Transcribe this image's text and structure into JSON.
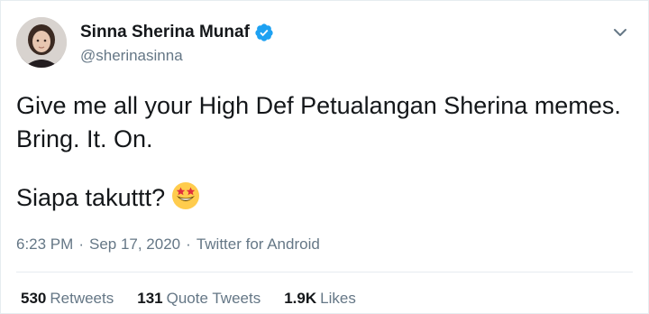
{
  "author": {
    "display_name": "Sinna Sherina Munaf",
    "handle": "@sherinasinna"
  },
  "tweet": {
    "line1": "Give me all your High Def Petualangan Sherina memes.",
    "line2": "Bring. It. On.",
    "line3": "Siapa takuttt?",
    "emoji": "star-struck-emoji"
  },
  "meta": {
    "time": "6:23 PM",
    "date": "Sep 17, 2020",
    "source": "Twitter for Android",
    "separator": "·"
  },
  "stats": {
    "retweets_count": "530",
    "retweets_label": "Retweets",
    "quotes_count": "131",
    "quotes_label": "Quote Tweets",
    "likes_count": "1.9K",
    "likes_label": "Likes"
  },
  "colors": {
    "verified_blue": "#1da1f2",
    "secondary_text": "#657786",
    "primary_text": "#14171a"
  }
}
